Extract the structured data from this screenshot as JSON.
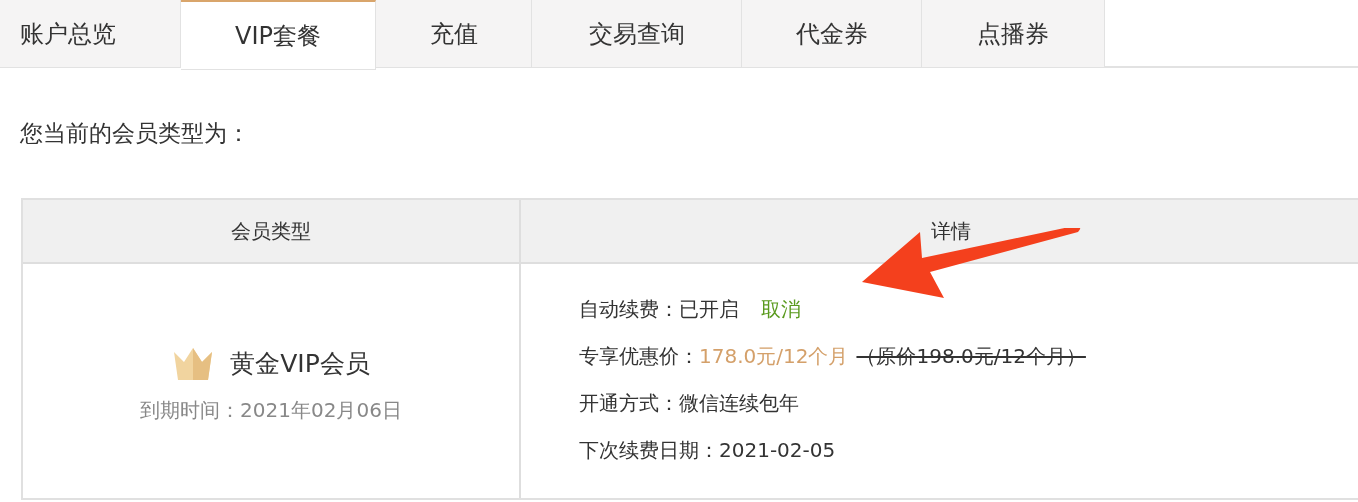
{
  "tabs": [
    {
      "label": "账户总览",
      "selected": false
    },
    {
      "label": "VIP套餐",
      "selected": true
    },
    {
      "label": "充值",
      "selected": false
    },
    {
      "label": "交易查询",
      "selected": false
    },
    {
      "label": "代金券",
      "selected": false
    },
    {
      "label": "点播券",
      "selected": false
    }
  ],
  "heading": "您当前的会员类型为：",
  "table": {
    "columns": [
      "会员类型",
      "详情"
    ],
    "membership": {
      "name": "黄金VIP会员",
      "expiry": "到期时间：2021年02月06日"
    },
    "details": [
      {
        "kind": "status",
        "label": "自动续费：",
        "value": "已开启",
        "action": "取消"
      },
      {
        "kind": "price",
        "label": "专享优惠价：",
        "price": "178.0元/12个月",
        "original": "（原价198.0元/12个月）"
      },
      {
        "kind": "text",
        "label": "开通方式：",
        "value": "微信连续包年"
      },
      {
        "kind": "text",
        "label": "下次续费日期：",
        "value": "2021-02-05"
      }
    ]
  }
}
